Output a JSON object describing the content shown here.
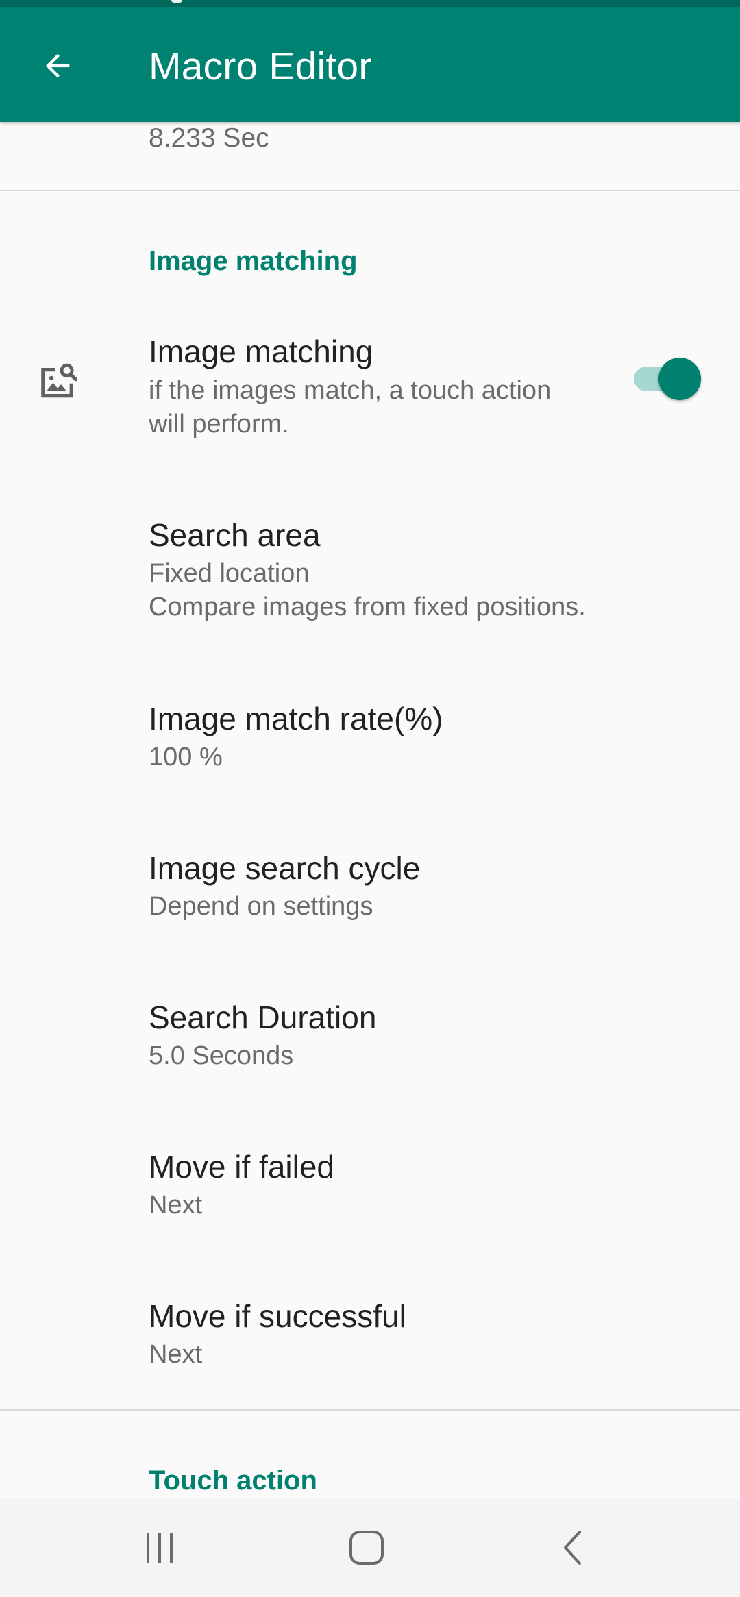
{
  "app_bar": {
    "title": "Macro Editor"
  },
  "icons": {
    "back": "arrow-left-icon",
    "image_matching": "image-search-icon",
    "recents": "recents-icon",
    "home": "home-icon",
    "nav_back": "chevron-left-icon"
  },
  "colors": {
    "primary": "#008272",
    "primary_dark": "#01695c",
    "accent": "#00806e",
    "toggle_track": "#a6d7d0"
  },
  "partial_item": {
    "summary": "8.233 Sec"
  },
  "sections": {
    "image_matching_header": "Image matching",
    "touch_action_header": "Touch action"
  },
  "prefs": {
    "image_matching": {
      "title": "Image matching",
      "summary": "if the images match, a touch action will perform.",
      "enabled": true
    },
    "search_area": {
      "title": "Search area",
      "summary": "Fixed location",
      "summary2": "Compare images from fixed positions."
    },
    "match_rate": {
      "title": "Image match rate(%)",
      "summary": "100 %"
    },
    "search_cycle": {
      "title": "Image search cycle",
      "summary": "Depend on settings"
    },
    "search_duration": {
      "title": "Search Duration",
      "summary": "5.0 Seconds"
    },
    "move_if_failed": {
      "title": "Move if failed",
      "summary": "Next"
    },
    "move_if_successful": {
      "title": "Move if successful",
      "summary": "Next"
    }
  }
}
